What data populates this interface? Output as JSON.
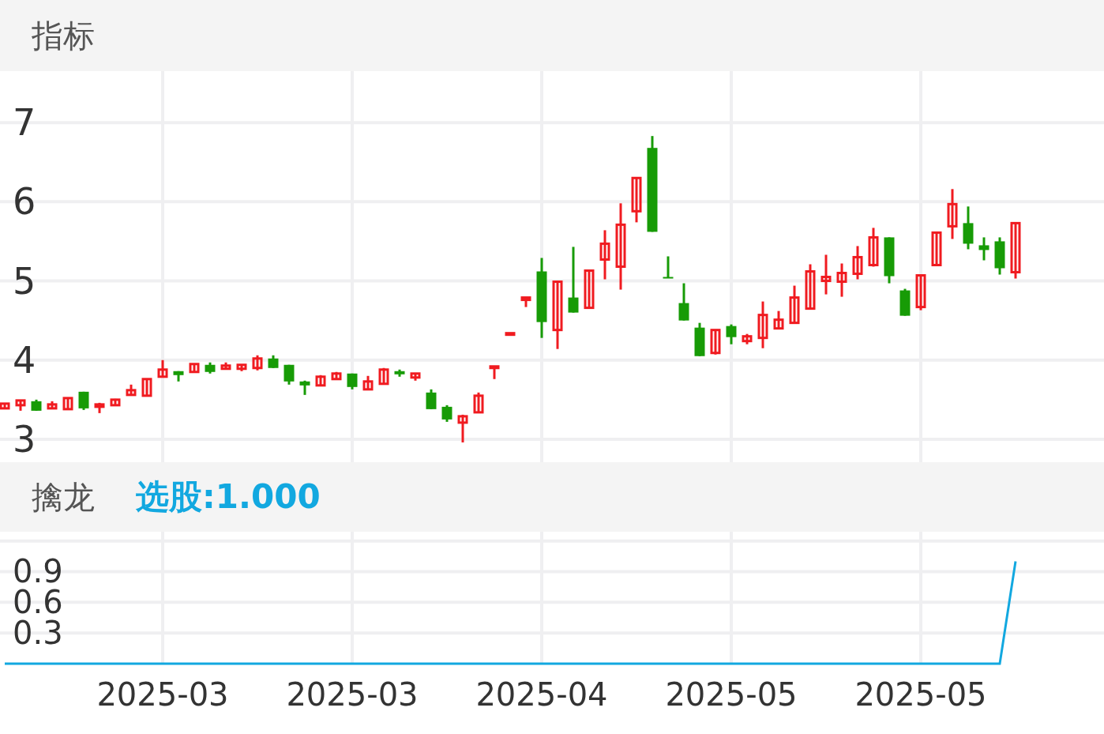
{
  "panels": [
    {
      "title": "指标",
      "chart_data": {
        "type": "candlestick",
        "grid": true,
        "ylim": [
          2.71,
          7.65
        ],
        "yticks": [
          3,
          4,
          5,
          6,
          7
        ],
        "categories": [
          null,
          null,
          null,
          null,
          null,
          null,
          null,
          null,
          null,
          null,
          null,
          null,
          null,
          null,
          null,
          null,
          null,
          null,
          null,
          null,
          null,
          null,
          null,
          null,
          null,
          null,
          null,
          null,
          null,
          null,
          null,
          null,
          null,
          null,
          null,
          null,
          null,
          null,
          null,
          null,
          null,
          null,
          null,
          null,
          null,
          null,
          null,
          null,
          null,
          null,
          null,
          null,
          null,
          null,
          null,
          null,
          null,
          null,
          null,
          null,
          null,
          null,
          null,
          null,
          null
        ],
        "ohlc": [
          [
            3.39,
            3.45,
            3.39,
            3.45
          ],
          [
            3.43,
            3.49,
            3.36,
            3.49
          ],
          [
            3.48,
            3.5,
            3.36,
            3.36
          ],
          [
            3.39,
            3.48,
            3.39,
            3.44
          ],
          [
            3.38,
            3.52,
            3.38,
            3.52
          ],
          [
            3.6,
            3.6,
            3.37,
            3.39
          ],
          [
            3.41,
            3.46,
            3.33,
            3.44
          ],
          [
            3.43,
            3.51,
            3.43,
            3.5
          ],
          [
            3.56,
            3.69,
            3.56,
            3.62
          ],
          [
            3.55,
            3.76,
            3.55,
            3.76
          ],
          [
            3.79,
            4.0,
            3.79,
            3.88
          ],
          [
            3.86,
            3.86,
            3.73,
            3.81
          ],
          [
            3.85,
            3.95,
            3.85,
            3.95
          ],
          [
            3.94,
            3.97,
            3.83,
            3.85
          ],
          [
            3.89,
            3.97,
            3.89,
            3.93
          ],
          [
            3.89,
            3.94,
            3.86,
            3.94
          ],
          [
            3.9,
            4.06,
            3.87,
            4.02
          ],
          [
            4.02,
            4.06,
            3.9,
            3.9
          ],
          [
            3.94,
            3.94,
            3.69,
            3.73
          ],
          [
            3.73,
            3.74,
            3.56,
            3.68
          ],
          [
            3.68,
            3.81,
            3.68,
            3.79
          ],
          [
            3.76,
            3.85,
            3.76,
            3.83
          ],
          [
            3.83,
            3.83,
            3.63,
            3.66
          ],
          [
            3.63,
            3.8,
            3.63,
            3.73
          ],
          [
            3.7,
            3.9,
            3.7,
            3.88
          ],
          [
            3.86,
            3.88,
            3.79,
            3.82
          ],
          [
            3.78,
            3.83,
            3.74,
            3.83
          ],
          [
            3.59,
            3.63,
            3.38,
            3.38
          ],
          [
            3.41,
            3.43,
            3.22,
            3.25
          ],
          [
            3.21,
            3.31,
            2.96,
            3.29
          ],
          [
            3.34,
            3.59,
            3.33,
            3.55
          ],
          [
            3.9,
            3.92,
            3.76,
            3.92
          ],
          [
            4.33,
            4.34,
            4.33,
            4.34
          ],
          [
            4.76,
            4.79,
            4.67,
            4.79
          ],
          [
            5.12,
            5.29,
            4.28,
            4.48
          ],
          [
            4.38,
            4.99,
            4.14,
            4.99
          ],
          [
            4.79,
            5.43,
            4.6,
            4.6
          ],
          [
            4.66,
            5.13,
            4.66,
            5.13
          ],
          [
            5.27,
            5.64,
            5.02,
            5.47
          ],
          [
            5.18,
            5.98,
            4.89,
            5.71
          ],
          [
            5.88,
            6.3,
            5.74,
            6.3
          ],
          [
            6.68,
            6.83,
            5.62,
            5.62
          ],
          [
            5.05,
            5.31,
            5.04,
            5.04
          ],
          [
            4.72,
            4.97,
            4.5,
            4.5
          ],
          [
            4.41,
            4.47,
            4.05,
            4.05
          ],
          [
            4.09,
            4.38,
            4.07,
            4.38
          ],
          [
            4.43,
            4.45,
            4.2,
            4.29
          ],
          [
            4.24,
            4.33,
            4.2,
            4.3
          ],
          [
            4.28,
            4.74,
            4.15,
            4.57
          ],
          [
            4.4,
            4.62,
            4.4,
            4.51
          ],
          [
            4.47,
            4.94,
            4.46,
            4.79
          ],
          [
            4.65,
            5.21,
            4.65,
            5.12
          ],
          [
            5.0,
            5.33,
            4.83,
            5.05
          ],
          [
            4.99,
            5.22,
            4.8,
            5.1
          ],
          [
            5.09,
            5.44,
            5.02,
            5.3
          ],
          [
            5.2,
            5.67,
            5.18,
            5.55
          ],
          [
            5.55,
            5.55,
            4.97,
            5.06
          ],
          [
            4.88,
            4.9,
            4.56,
            4.56
          ],
          [
            4.67,
            5.07,
            4.63,
            5.07
          ],
          [
            5.2,
            5.61,
            5.2,
            5.61
          ],
          [
            5.69,
            6.16,
            5.53,
            5.97
          ],
          [
            5.73,
            5.94,
            5.4,
            5.47
          ],
          [
            5.45,
            5.55,
            5.26,
            5.39
          ],
          [
            5.5,
            5.55,
            5.08,
            5.16
          ],
          [
            5.11,
            5.73,
            5.03,
            5.73
          ]
        ]
      }
    },
    {
      "title": "擒龙",
      "indicator": "选股:1.000",
      "chart_data": {
        "type": "line",
        "grid": true,
        "ylim": [
          0,
          1.29
        ],
        "yticks": [
          0.3,
          0.6,
          0.9
        ],
        "categories": [
          null,
          null,
          null,
          null,
          null,
          null,
          null,
          null,
          null,
          null,
          "2025-03",
          null,
          null,
          null,
          null,
          null,
          null,
          null,
          null,
          null,
          null,
          null,
          "2025-03",
          null,
          null,
          null,
          null,
          null,
          null,
          null,
          null,
          null,
          null,
          null,
          "2025-04",
          null,
          null,
          null,
          null,
          null,
          null,
          null,
          null,
          null,
          null,
          null,
          "2025-05",
          null,
          null,
          null,
          null,
          null,
          null,
          null,
          null,
          null,
          null,
          null,
          "2025-05",
          null,
          null,
          null,
          null,
          null,
          null
        ],
        "series": [
          {
            "color": "#12a8e0",
            "values": [
              0,
              0,
              0,
              0,
              0,
              0,
              0,
              0,
              0,
              0,
              0,
              0,
              0,
              0,
              0,
              0,
              0,
              0,
              0,
              0,
              0,
              0,
              0,
              0,
              0,
              0,
              0,
              0,
              0,
              0,
              0,
              0,
              0,
              0,
              0,
              0,
              0,
              0,
              0,
              0,
              0,
              0,
              0,
              0,
              0,
              0,
              0,
              0,
              0,
              0,
              0,
              0,
              0,
              0,
              0,
              0,
              0,
              0,
              0,
              0,
              0,
              0,
              0,
              0,
              1
            ]
          }
        ]
      }
    }
  ]
}
